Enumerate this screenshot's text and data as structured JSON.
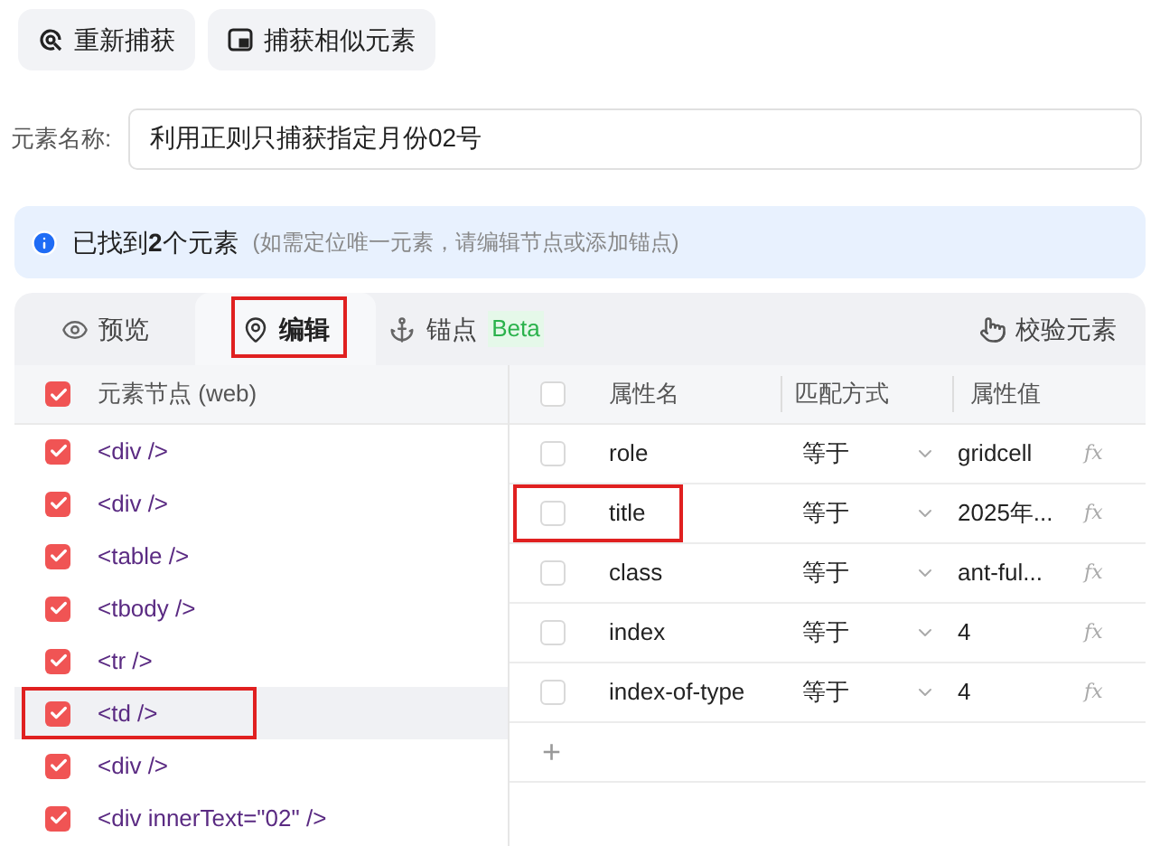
{
  "toolbar": [
    {
      "kind": "recapture",
      "label": "重新捕获"
    },
    {
      "kind": "similar",
      "label": "捕获相似元素"
    }
  ],
  "element_name": {
    "label": "元素名称:",
    "value": "利用正则只捕获指定月份02号"
  },
  "info": {
    "text": "已找到**2**个元素",
    "hint": "(如需定位唯一元素，请编辑节点或添加锚点)"
  },
  "tabs": [
    {
      "kind": "preview",
      "label": "预览",
      "selected": false,
      "highlighted": false
    },
    {
      "kind": "edit",
      "label": "编辑",
      "selected": true,
      "highlighted": true
    },
    {
      "kind": "anchor",
      "label": "锚点",
      "badge": "Beta",
      "selected": false,
      "highlighted": false
    }
  ],
  "verify_button": "校验元素",
  "nodes": {
    "header": "元素节点 (web)",
    "all_checked": true,
    "items": [
      {
        "label": "<div />",
        "checked": true,
        "selected": false,
        "highlighted": false
      },
      {
        "label": "<div />",
        "checked": true,
        "selected": false,
        "highlighted": false
      },
      {
        "label": "<table />",
        "checked": true,
        "selected": false,
        "highlighted": false
      },
      {
        "label": "<tbody />",
        "checked": true,
        "selected": false,
        "highlighted": false
      },
      {
        "label": "<tr />",
        "checked": true,
        "selected": false,
        "highlighted": false
      },
      {
        "label": "<td />",
        "checked": true,
        "selected": true,
        "highlighted": true
      },
      {
        "label": "<div />",
        "checked": true,
        "selected": false,
        "highlighted": false
      },
      {
        "label": "<div innerText=\"02\" />",
        "checked": true,
        "selected": false,
        "highlighted": false
      }
    ]
  },
  "attributes": {
    "columns": [
      "属性名",
      "匹配方式",
      "属性值"
    ],
    "all_checked": false,
    "add": "+",
    "rows": [
      {
        "name": "role",
        "match": "等于",
        "value": "gridcell",
        "formula": "fx",
        "checked": false,
        "highlighted": false
      },
      {
        "name": "title",
        "match": "等于",
        "value": "2025年...",
        "formula": "fx",
        "checked": false,
        "highlighted": true
      },
      {
        "name": "class",
        "match": "等于",
        "value": "ant-ful...",
        "formula": "fx",
        "checked": false,
        "highlighted": false
      },
      {
        "name": "index",
        "match": "等于",
        "value": "4",
        "formula": "fx",
        "checked": false,
        "highlighted": false
      },
      {
        "name": "index-of-type",
        "match": "等于",
        "value": "4",
        "formula": "fx",
        "checked": false,
        "highlighted": false
      }
    ]
  }
}
